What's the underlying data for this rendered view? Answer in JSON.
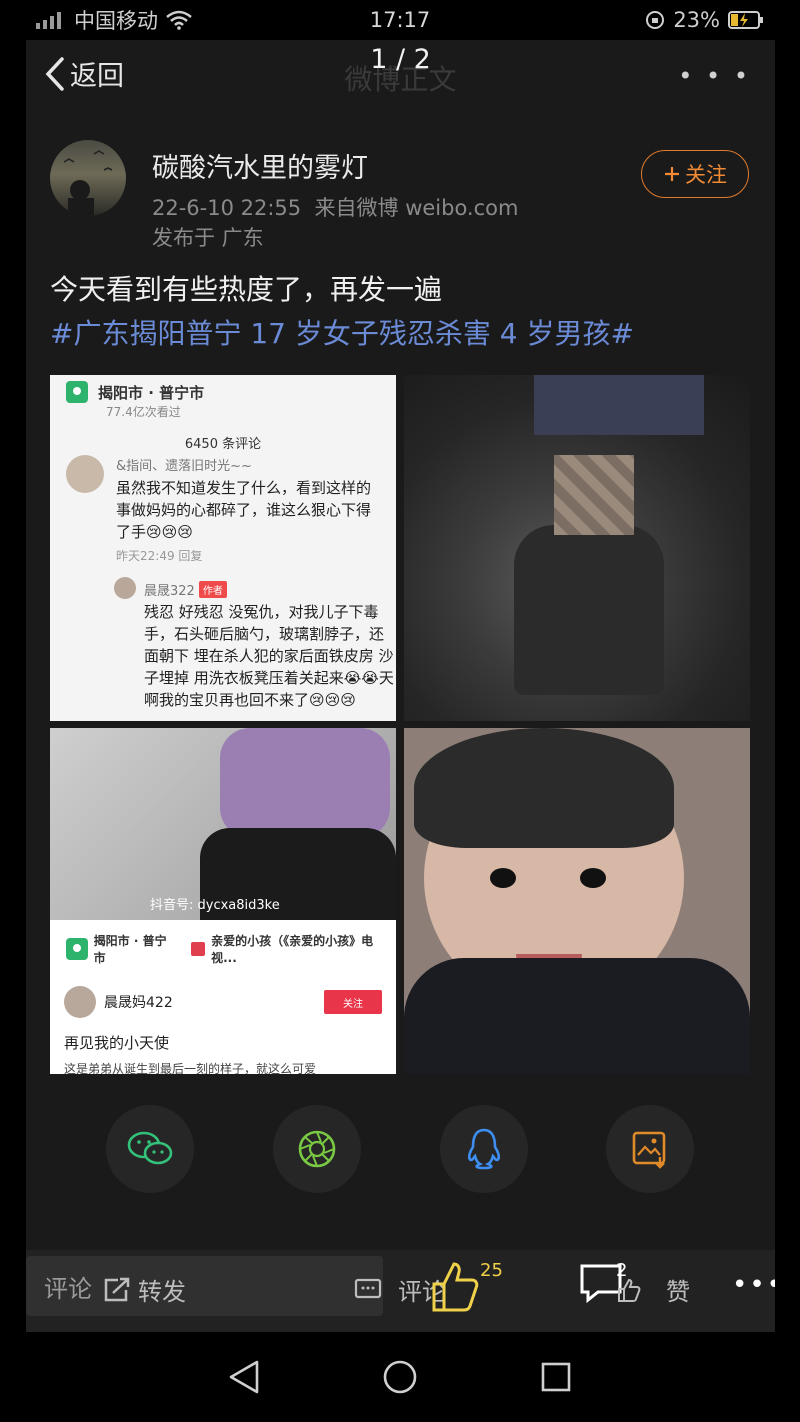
{
  "status_bar": {
    "carrier": "中国移动",
    "time": "17:17",
    "battery": "23%"
  },
  "header": {
    "back_label": "返回",
    "faded_title": "微博正文",
    "pager": "1 / 2",
    "more": "• • •"
  },
  "post": {
    "username": "碳酸汽水里的雾灯",
    "timestamp": "22-6-10 22:55",
    "source": "来自微博 weibo.com",
    "location": "发布于 广东",
    "follow_label": "关注",
    "text": "今天看到有些热度了，再发一遍",
    "hashtag": "#广东揭阳普宁 17 岁女子残忍杀害 4 岁男孩#"
  },
  "image1": {
    "location": "揭阳市 · 普宁市",
    "views": "77.4亿次看过",
    "comment_count": "6450 条评论",
    "commenter": "&指间、遗落旧时光~~",
    "comment_body": "虽然我不知道发生了什么，看到这样的事做妈妈的心都碎了，谁这么狠心下得了手😢😢😢",
    "comment_time": "昨天22:49   回复",
    "reply_name": "晨晟322",
    "reply_tag": "作者",
    "reply_body": "残忍 好残忍 没冤仇，对我儿子下毒手，石头砸后脑勺，玻璃割脖子，还面朝下 埋在杀人犯的家后面铁皮房 沙子埋掉 用洗衣板凳压着关起来😭😭天啊我的宝贝再也回不来了😢😢😢"
  },
  "image3": {
    "douyin_id": "抖音号: dycxa8id3ke",
    "tag_location": "揭阳市 · 普宁市",
    "tag_music": "亲爱的小孩（《亲爱的小孩》电视...",
    "username": "晨晟妈422",
    "follow": "关注",
    "line1": "再见我的小天使",
    "line2": "这是弟弟从诞生到最后一刻的样子，就这么可爱"
  },
  "share": {
    "wechat": "wechat-icon",
    "moments": "moments-icon",
    "qq": "qq-icon",
    "save": "save-image-icon"
  },
  "bottom": {
    "comment_placeholder": "评论",
    "forward": "转发",
    "comment": "评论",
    "likes": "25",
    "comments": "2",
    "zan": "赞",
    "more": "•••"
  },
  "colors": {
    "accent": "#f08a35",
    "hashtag": "#6b8bd6",
    "like": "#f0d14a"
  }
}
